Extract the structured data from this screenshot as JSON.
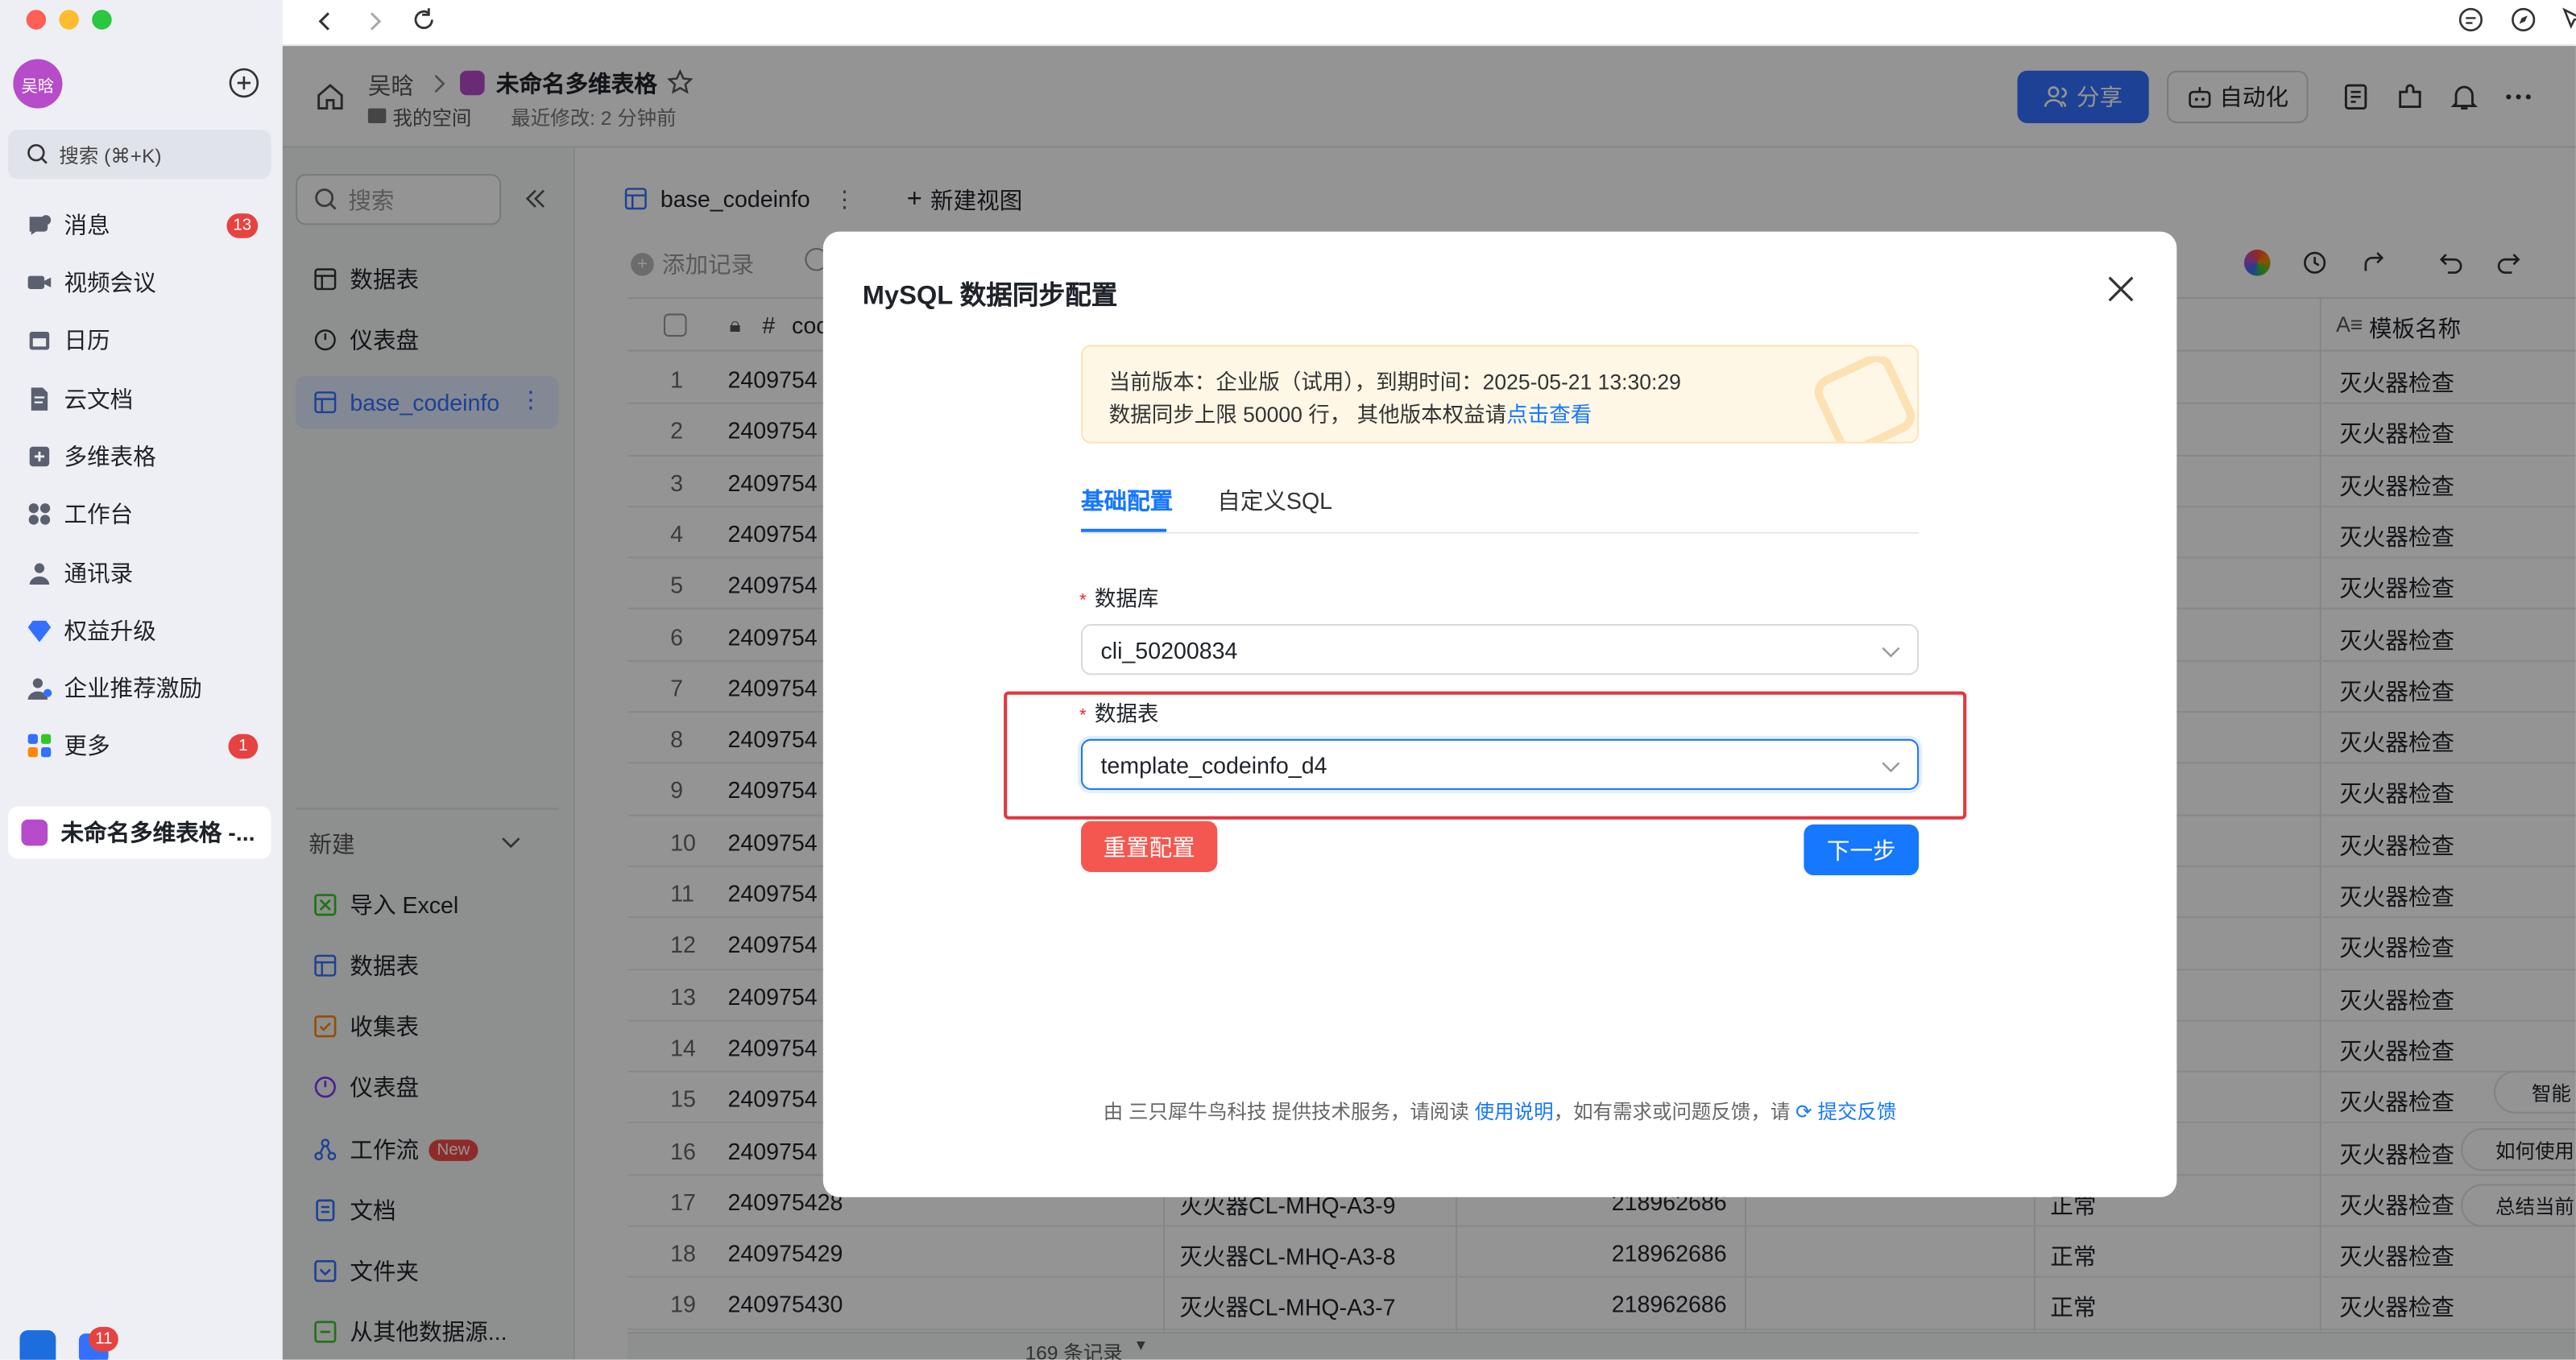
{
  "app": {
    "avatar_text": "吴晗",
    "search_placeholder": "搜索 (⌘+K)",
    "nav": [
      {
        "label": "消息",
        "badge": "13",
        "icon": "chat-bubble-icon"
      },
      {
        "label": "视频会议",
        "badge": "",
        "icon": "video-camera-icon"
      },
      {
        "label": "日历",
        "badge": "",
        "icon": "calendar-icon"
      },
      {
        "label": "云文档",
        "badge": "",
        "icon": "document-icon"
      },
      {
        "label": "多维表格",
        "badge": "",
        "icon": "base-icon"
      },
      {
        "label": "工作台",
        "badge": "",
        "icon": "apps-grid-icon"
      },
      {
        "label": "通讯录",
        "badge": "",
        "icon": "contacts-icon"
      },
      {
        "label": "权益升级",
        "badge": "",
        "icon": "diamond-icon"
      },
      {
        "label": "企业推荐激励",
        "badge": "",
        "icon": "referral-icon"
      },
      {
        "label": "更多",
        "badge": "1",
        "icon": "more-apps-icon"
      }
    ],
    "open_doc": "未命名多维表格 -...",
    "dock_badge": "11"
  },
  "header": {
    "breadcrumb_user": "吴晗",
    "title": "未命名多维表格",
    "space": "我的空间",
    "last_modified": "最近修改: 2 分钟前",
    "share_label": "分享",
    "automation_label": "自动化"
  },
  "inner_sidebar": {
    "search_placeholder": "搜索",
    "items": [
      "数据表",
      "仪表盘",
      "base_codeinfo"
    ],
    "new_label": "新建",
    "new_items": [
      {
        "label": "导入 Excel",
        "icon": "excel-icon"
      },
      {
        "label": "数据表",
        "icon": "table-icon"
      },
      {
        "label": "收集表",
        "icon": "form-icon"
      },
      {
        "label": "仪表盘",
        "icon": "dashboard-icon"
      },
      {
        "label": "工作流",
        "icon": "workflow-icon",
        "tag": "New"
      },
      {
        "label": "文档",
        "icon": "doc-icon"
      },
      {
        "label": "文件夹",
        "icon": "folder-icon"
      },
      {
        "label": "从其他数据源...",
        "icon": "datasource-icon"
      }
    ]
  },
  "table": {
    "tab_name": "base_codeinfo",
    "new_view": "新建视图",
    "add_record": "添加记录",
    "col_code": "coc",
    "col_template": "模板名称",
    "rows": [
      {
        "n": "1",
        "code": "2409754",
        "name": "",
        "num": "",
        "status": "",
        "tpl": "灭火器检查"
      },
      {
        "n": "2",
        "code": "2409754",
        "name": "",
        "num": "",
        "status": "",
        "tpl": "灭火器检查"
      },
      {
        "n": "3",
        "code": "2409754",
        "name": "",
        "num": "",
        "status": "",
        "tpl": "灭火器检查"
      },
      {
        "n": "4",
        "code": "2409754",
        "name": "",
        "num": "",
        "status": "",
        "tpl": "灭火器检查"
      },
      {
        "n": "5",
        "code": "2409754",
        "name": "",
        "num": "",
        "status": "",
        "tpl": "灭火器检查"
      },
      {
        "n": "6",
        "code": "2409754",
        "name": "",
        "num": "",
        "status": "",
        "tpl": "灭火器检查"
      },
      {
        "n": "7",
        "code": "2409754",
        "name": "",
        "num": "",
        "status": "",
        "tpl": "灭火器检查"
      },
      {
        "n": "8",
        "code": "2409754",
        "name": "",
        "num": "",
        "status": "",
        "tpl": "灭火器检查"
      },
      {
        "n": "9",
        "code": "2409754",
        "name": "",
        "num": "",
        "status": "",
        "tpl": "灭火器检查"
      },
      {
        "n": "10",
        "code": "2409754",
        "name": "",
        "num": "",
        "status": "",
        "tpl": "灭火器检查"
      },
      {
        "n": "11",
        "code": "2409754",
        "name": "",
        "num": "",
        "status": "",
        "tpl": "灭火器检查"
      },
      {
        "n": "12",
        "code": "2409754",
        "name": "",
        "num": "",
        "status": "",
        "tpl": "灭火器检查"
      },
      {
        "n": "13",
        "code": "2409754",
        "name": "",
        "num": "",
        "status": "",
        "tpl": "灭火器检查"
      },
      {
        "n": "14",
        "code": "2409754",
        "name": "",
        "num": "",
        "status": "",
        "tpl": "灭火器检查"
      },
      {
        "n": "15",
        "code": "2409754",
        "name": "",
        "num": "",
        "status": "",
        "tpl": "灭火器检查"
      },
      {
        "n": "16",
        "code": "2409754",
        "name": "",
        "num": "",
        "status": "",
        "tpl": "灭火器检查"
      },
      {
        "n": "17",
        "code": "240975428",
        "name": "灭火器CL-MHQ-A3-9",
        "num": "218962686",
        "status": "正常",
        "tpl": "灭火器检查"
      },
      {
        "n": "18",
        "code": "240975429",
        "name": "灭火器CL-MHQ-A3-8",
        "num": "218962686",
        "status": "正常",
        "tpl": "灭火器检查"
      },
      {
        "n": "19",
        "code": "240975430",
        "name": "灭火器CL-MHQ-A3-7",
        "num": "218962686",
        "status": "正常",
        "tpl": "灭火器检查"
      }
    ],
    "record_count": "169 条记录",
    "side_tools": [
      "智能",
      "如何使用",
      "总结当前"
    ]
  },
  "dialog": {
    "title": "MySQL 数据同步配置",
    "notice_line1": "当前版本：企业版（试用），到期时间：2025-05-21 13:30:29",
    "notice_line2": "数据同步上限 50000 行， 其他版本权益请",
    "notice_link": "点击查看",
    "tabs": [
      "基础配置",
      "自定义SQL"
    ],
    "db_label": "数据库",
    "db_value": "cli_50200834",
    "table_label": "数据表",
    "table_value": "template_codeinfo_d4",
    "required_mark": "*",
    "reset_button": "重置配置",
    "next_button": "下一步",
    "footer_prefix": "由 三只犀牛鸟科技 提供技术服务，请阅读",
    "footer_link1": "使用说明",
    "footer_middle": "，如有需求或问题反馈，请",
    "footer_link2": "提交反馈",
    "highlight_color": "#e0383e",
    "accent_color": "#1677ff"
  }
}
